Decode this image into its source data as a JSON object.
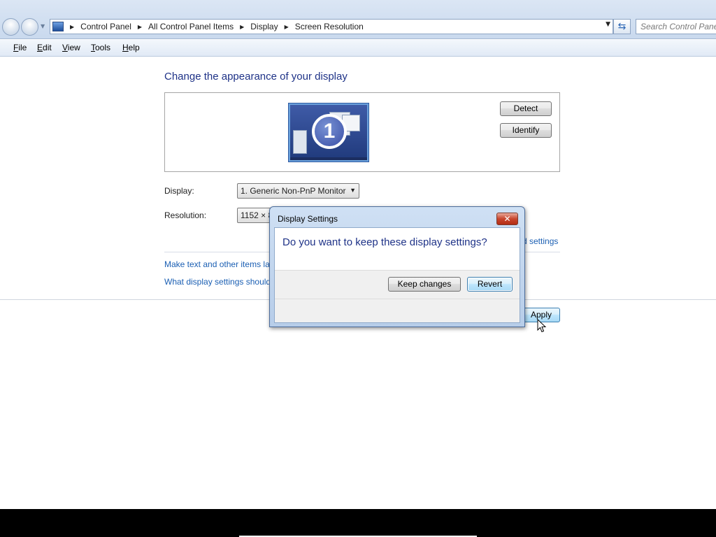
{
  "breadcrumb": [
    "Control Panel",
    "All Control Panel Items",
    "Display",
    "Screen Resolution"
  ],
  "search": {
    "placeholder": "Search Control Panel"
  },
  "menu": [
    "File",
    "Edit",
    "View",
    "Tools",
    "Help"
  ],
  "main": {
    "heading": "Change the appearance of your display",
    "monitor_number": "1",
    "detect_label": "Detect",
    "identify_label": "Identify",
    "display_label": "Display:",
    "display_value": "1. Generic Non-PnP Monitor",
    "resolution_label": "Resolution:",
    "resolution_value": "1152 × 8",
    "advanced_settings_link": "d settings",
    "link_text_size": "Make text and other items la",
    "link_display_settings": "What display settings should",
    "apply_label": "Apply"
  },
  "dialog": {
    "title": "Display Settings",
    "close_glyph": "✕",
    "question": "Do you want to keep these display settings?",
    "keep_label": "Keep changes",
    "revert_label": "Revert"
  }
}
